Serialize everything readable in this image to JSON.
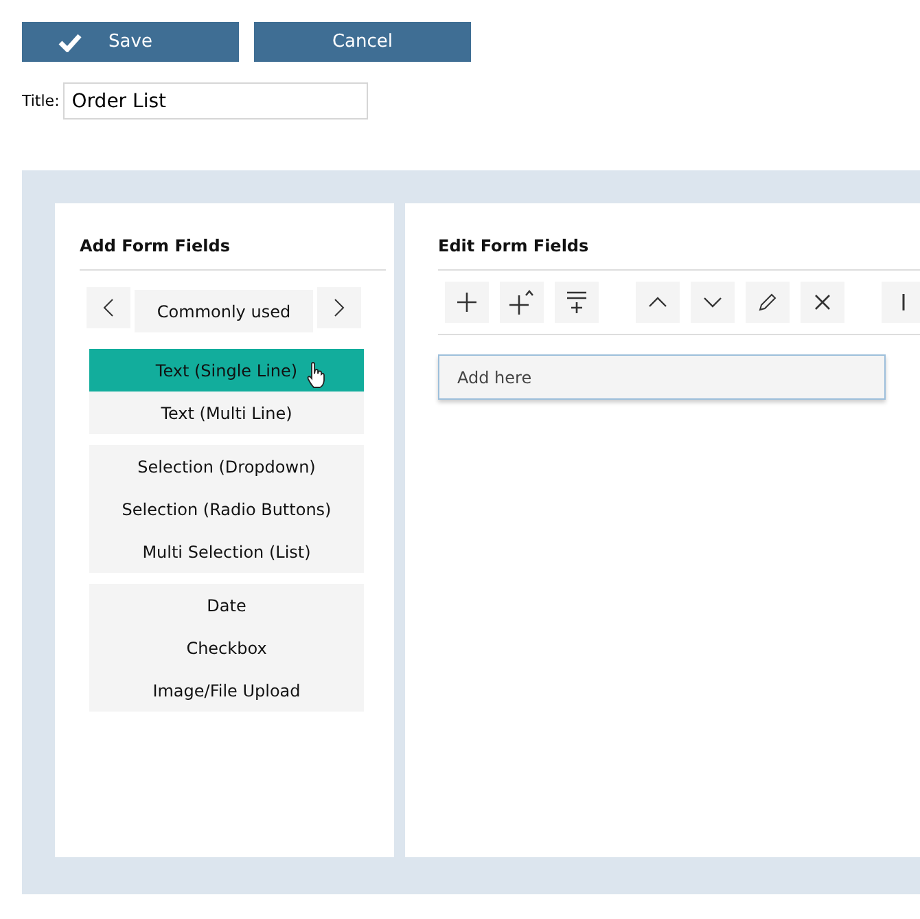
{
  "actions": [
    {
      "label": "Save",
      "kind": "check"
    },
    {
      "label": "Cancel",
      "kind": "plain"
    }
  ],
  "title_field": {
    "label": "Title:",
    "value": "Order List"
  },
  "add_panel": {
    "heading": "Add Form Fields",
    "category": "Commonly used",
    "groups": [
      [
        {
          "label": "Text (Single Line)",
          "selected": true
        },
        {
          "label": "Text (Multi Line)",
          "selected": false
        }
      ],
      [
        {
          "label": "Selection (Dropdown)",
          "selected": false
        },
        {
          "label": "Selection (Radio Buttons)",
          "selected": false
        },
        {
          "label": "Multi Selection (List)",
          "selected": false
        }
      ],
      [
        {
          "label": "Date",
          "selected": false
        },
        {
          "label": "Checkbox",
          "selected": false
        },
        {
          "label": "Image/File Upload",
          "selected": false
        }
      ]
    ]
  },
  "edit_panel": {
    "heading": "Edit Form Fields",
    "tools": [
      {
        "kind": "add"
      },
      {
        "kind": "add-above"
      },
      {
        "kind": "add-below"
      },
      {
        "kind": "gap"
      },
      {
        "kind": "up"
      },
      {
        "kind": "down"
      },
      {
        "kind": "edit"
      },
      {
        "kind": "delete"
      },
      {
        "kind": "gap"
      },
      {
        "kind": "bar"
      }
    ],
    "dropzone": "Add here"
  }
}
